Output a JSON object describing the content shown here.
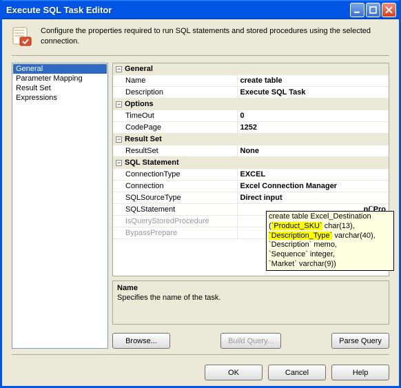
{
  "window": {
    "title": "Execute SQL Task Editor"
  },
  "header": {
    "description": "Configure the properties required to run SQL statements and stored procedures using the selected connection."
  },
  "nav": {
    "items": [
      {
        "label": "General",
        "selected": true
      },
      {
        "label": "Parameter Mapping"
      },
      {
        "label": "Result Set"
      },
      {
        "label": "Expressions"
      }
    ]
  },
  "props": {
    "general": {
      "cat": "General",
      "name_label": "Name",
      "name_value": "create table",
      "desc_label": "Description",
      "desc_value": "Execute SQL Task"
    },
    "options": {
      "cat": "Options",
      "timeout_label": "TimeOut",
      "timeout_value": "0",
      "codepage_label": "CodePage",
      "codepage_value": "1252"
    },
    "resultset": {
      "cat": "Result Set",
      "rs_label": "ResultSet",
      "rs_value": "None"
    },
    "sql": {
      "cat": "SQL Statement",
      "conntype_label": "ConnectionType",
      "conntype_value": "EXCEL",
      "conn_label": "Connection",
      "conn_value": "Excel Connection Manager",
      "srctype_label": "SQLSourceType",
      "srctype_value": "Direct input",
      "stmt_label": "SQLStatement",
      "stmt_value_truncated": "n(`Pro",
      "isquery_label": "IsQueryStoredProcedure",
      "bypass_label": "BypassPrepare"
    }
  },
  "tooltip": {
    "line1_a": "create table Excel_Destination",
    "line2_a": "(",
    "line2_hl": "`Product_SKU`",
    "line2_b": " char(13),",
    "line3_hl": "`Description_Type`",
    "line3_b": " varchar(40),",
    "line4": "`Description` memo,",
    "line5": "`Sequence` integer,",
    "line6": "`Market` varchar(9))"
  },
  "help": {
    "title": "Name",
    "body": "Specifies the name of the task."
  },
  "buttons": {
    "browse": "Browse...",
    "build_query": "Build Query...",
    "parse_query": "Parse Query",
    "ok": "OK",
    "cancel": "Cancel",
    "help": "Help"
  }
}
